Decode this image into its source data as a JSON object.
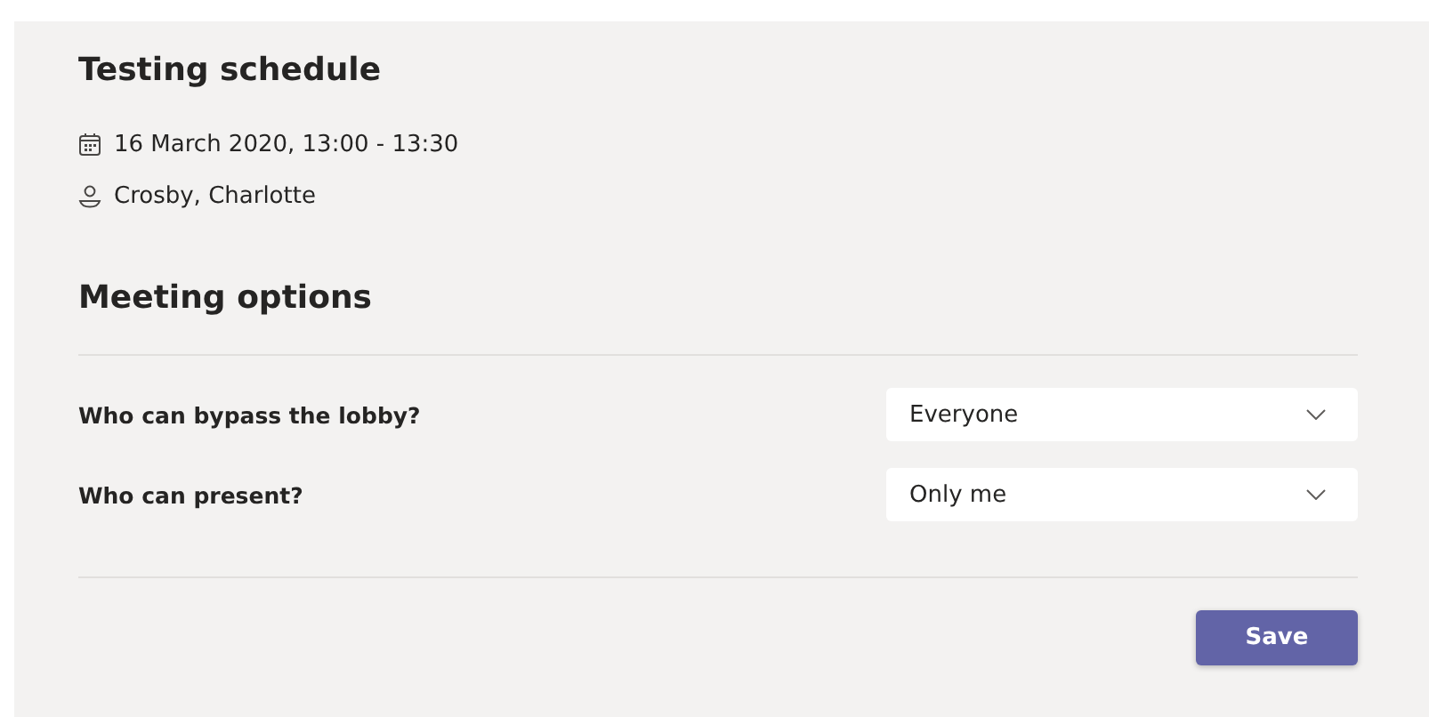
{
  "meeting": {
    "title": "Testing schedule",
    "date_time": "16 March 2020, 13:00 - 13:30",
    "organizer": "Crosby, Charlotte"
  },
  "options": {
    "heading": "Meeting options",
    "rows": [
      {
        "label": "Who can bypass the lobby?",
        "value": "Everyone"
      },
      {
        "label": "Who can present?",
        "value": "Only me"
      }
    ]
  },
  "save_button": "Save"
}
